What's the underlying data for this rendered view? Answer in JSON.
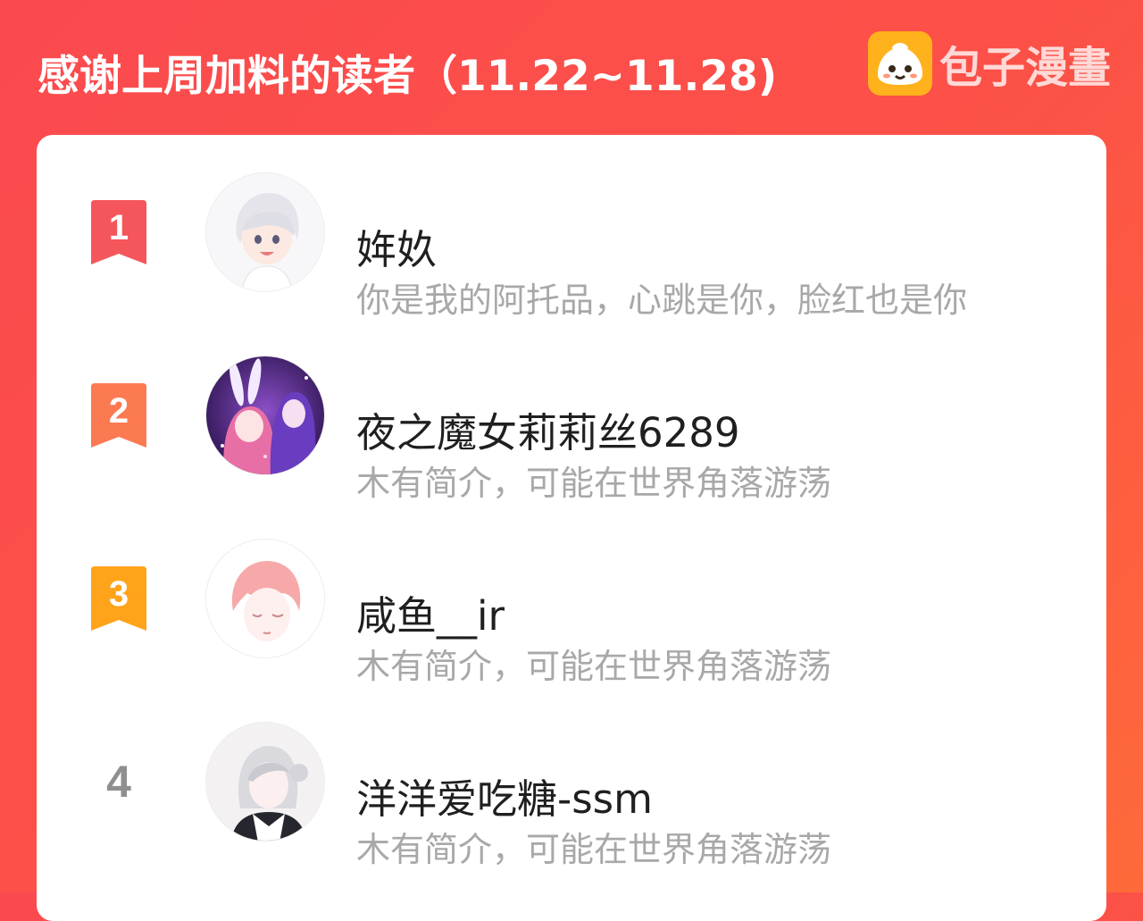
{
  "header": {
    "title": "感谢上周加料的读者（11.22~11.28)",
    "brand_name": "包子漫畫",
    "brand_icon": "bun-mascot-icon"
  },
  "colors": {
    "background": "#fb4a4f",
    "rank1": "#f5565c",
    "rank2": "#fb7a52",
    "rank3": "#ffa31a",
    "brand_icon_bg": "#ffb21c"
  },
  "readers": [
    {
      "rank": "1",
      "name": "姩奺",
      "bio": "你是我的阿托品，心跳是你，脸红也是你",
      "avatar": "anime-boy-white-hair-avatar"
    },
    {
      "rank": "2",
      "name": "夜之魔女莉莉丝6289",
      "bio": "木有简介，可能在世界角落游荡",
      "avatar": "anime-couple-purple-avatar"
    },
    {
      "rank": "3",
      "name": "咸鱼__ir",
      "bio": "木有简介，可能在世界角落游荡",
      "avatar": "pink-hair-boy-avatar"
    },
    {
      "rank": "4",
      "name": "洋洋爱吃糖-ssm",
      "bio": "木有简介，可能在世界角落游荡",
      "avatar": "white-hair-girl-avatar"
    }
  ]
}
